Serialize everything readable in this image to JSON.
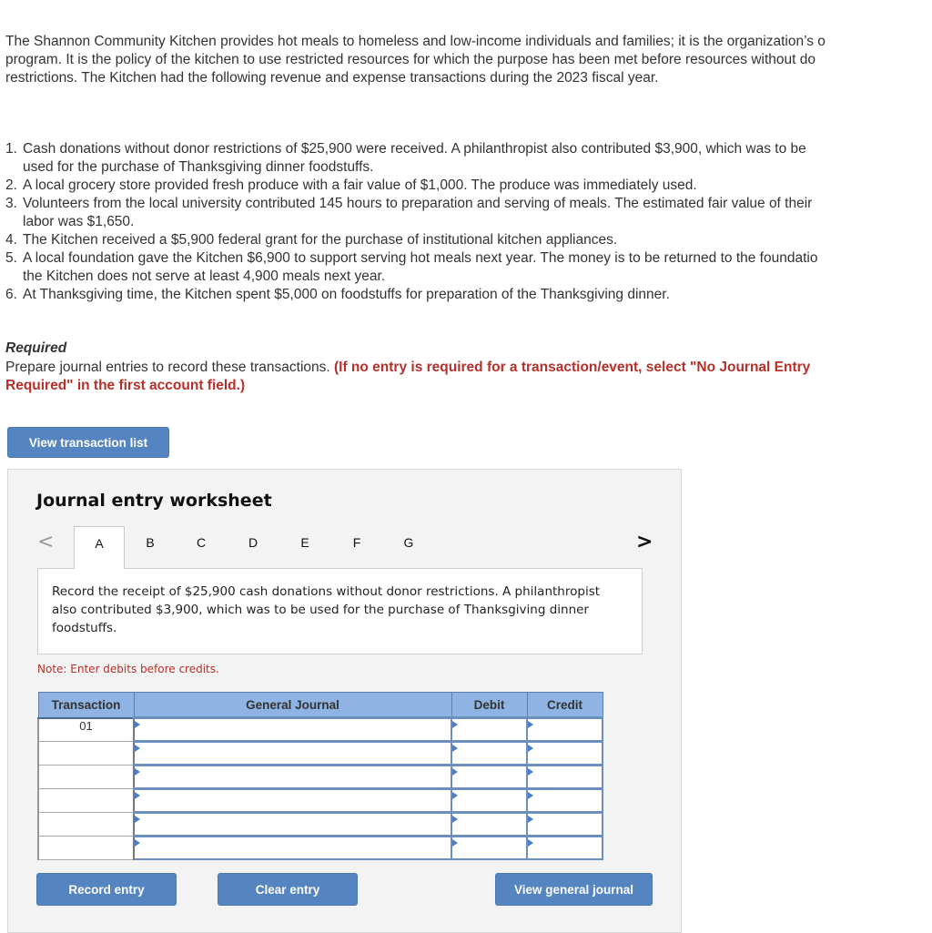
{
  "intro": {
    "line1": "The Shannon Community Kitchen provides hot meals to homeless and low-income individuals and families; it is the organization’s o",
    "line2": "program. It is the policy of the kitchen to use restricted resources for which the purpose has been met before resources without do",
    "line3": "restrictions. The Kitchen had the following revenue and expense transactions during the 2023 fiscal year."
  },
  "transactions": [
    {
      "num": "1.",
      "line1": "Cash donations without donor restrictions of $25,900 were received. A philanthropist also contributed $3,900, which was to be",
      "line2": "used for the purchase of Thanksgiving dinner foodstuffs."
    },
    {
      "num": "2.",
      "line1": "A local grocery store provided fresh produce with a fair value of $1,000. The produce was immediately used.",
      "line2": null
    },
    {
      "num": "3.",
      "line1": "Volunteers from the local university contributed 145 hours to preparation and serving of meals. The estimated fair value of their",
      "line2": "labor was $1,650."
    },
    {
      "num": "4.",
      "line1": "The Kitchen received a $5,900 federal grant for the purchase of institutional kitchen appliances.",
      "line2": null
    },
    {
      "num": "5.",
      "line1": "A local foundation gave the Kitchen $6,900 to support serving hot meals next year. The money is to be returned to the foundatio",
      "line2": "the Kitchen does not serve at least 4,900 meals next year."
    },
    {
      "num": "6.",
      "line1": "At Thanksgiving time, the Kitchen spent $5,000 on foodstuffs for preparation of the Thanksgiving dinner.",
      "line2": null
    }
  ],
  "required": {
    "title": "Required",
    "text": "Prepare journal entries to record these transactions. ",
    "instruction_line1": "(If no entry is required for a transaction/event, select \"No Journal Entry",
    "instruction_line2": "Required\" in the first account field.)"
  },
  "buttons": {
    "view_transaction_list": "View transaction list",
    "record_entry": "Record entry",
    "clear_entry": "Clear entry",
    "view_general_journal": "View general journal"
  },
  "worksheet": {
    "title": "Journal entry worksheet",
    "prev_icon": "<",
    "next_icon": ">",
    "tabs": [
      "A",
      "B",
      "C",
      "D",
      "E",
      "F",
      "G"
    ],
    "active_tab": "A",
    "description": "Record the receipt of $25,900 cash donations without donor restrictions. A philanthropist also contributed $3,900, which was to be used for the purchase of Thanksgiving dinner foodstuffs.",
    "note": "Note: Enter debits before credits.",
    "table": {
      "headers": [
        "Transaction",
        "General Journal",
        "Debit",
        "Credit"
      ],
      "rows": [
        {
          "transaction": "01",
          "account": "",
          "debit": "",
          "credit": ""
        },
        {
          "transaction": "",
          "account": "",
          "debit": "",
          "credit": ""
        },
        {
          "transaction": "",
          "account": "",
          "debit": "",
          "credit": ""
        },
        {
          "transaction": "",
          "account": "",
          "debit": "",
          "credit": ""
        },
        {
          "transaction": "",
          "account": "",
          "debit": "",
          "credit": ""
        },
        {
          "transaction": "",
          "account": "",
          "debit": "",
          "credit": ""
        }
      ]
    }
  },
  "colors": {
    "button_blue": "#5585c1",
    "header_blue": "#8fb4e3",
    "instruction_red": "#b5302a"
  }
}
